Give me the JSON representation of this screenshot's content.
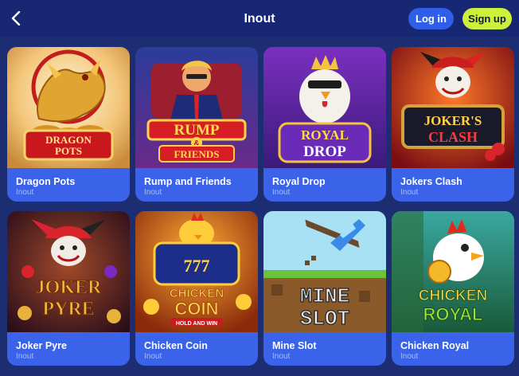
{
  "header": {
    "title": "Inout",
    "login_label": "Log in",
    "signup_label": "Sign up",
    "back_icon": "chevron-left-icon"
  },
  "games": [
    {
      "name": "Dragon Pots",
      "provider": "Inout",
      "logo_lines": [
        "DRAGON",
        "POTS"
      ]
    },
    {
      "name": "Rump and Friends",
      "provider": "Inout",
      "logo_lines": [
        "RUMP",
        "&",
        "FRIENDS"
      ]
    },
    {
      "name": "Royal Drop",
      "provider": "Inout",
      "logo_lines": [
        "ROYAL",
        "DROP"
      ]
    },
    {
      "name": "Jokers Clash",
      "provider": "Inout",
      "logo_lines": [
        "JOKER'S",
        "CLASH"
      ]
    },
    {
      "name": "Joker Pyre",
      "provider": "Inout",
      "logo_lines": [
        "JOKER",
        "PYRE"
      ]
    },
    {
      "name": "Chicken Coin",
      "provider": "Inout",
      "logo_lines": [
        "777",
        "CHICKEN",
        "COIN",
        "HOLD AND WIN"
      ]
    },
    {
      "name": "Mine Slot",
      "provider": "Inout",
      "logo_lines": [
        "MINE",
        "SLOT"
      ]
    },
    {
      "name": "Chicken Royal",
      "provider": "Inout",
      "logo_lines": [
        "CHICKEN",
        "ROYAL"
      ]
    }
  ],
  "colors": {
    "header_bg": "#182774",
    "page_bg": "#1c2d72",
    "card_bg": "#3b63ea",
    "login_bg": "#2f5ee9",
    "signup_bg": "#cdf03a"
  }
}
